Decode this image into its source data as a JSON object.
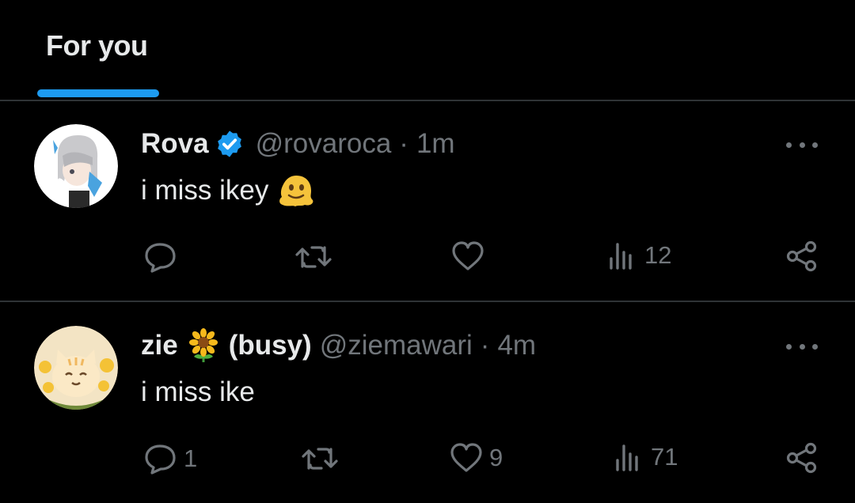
{
  "tabs": [
    {
      "label": "For you",
      "selected": true
    }
  ],
  "accent": "#1d9bf0",
  "tweets": [
    {
      "name": "Rova",
      "verified": true,
      "handle": "@rovaroca",
      "time": "1m",
      "text": "i miss ikey",
      "text_emoji": "melting-face",
      "replies": "",
      "reposts": "",
      "likes": "",
      "views": "12",
      "avatar": "anime-character-avatar"
    },
    {
      "name": "zie",
      "name_emoji": "sunflower",
      "name_suffix": "(busy)",
      "verified": false,
      "handle": "@ziemawari",
      "time": "4m",
      "text": "i miss ike",
      "replies": "1",
      "reposts": "",
      "likes": "9",
      "views": "71",
      "avatar": "cat-avatar"
    }
  ],
  "separator": "·"
}
